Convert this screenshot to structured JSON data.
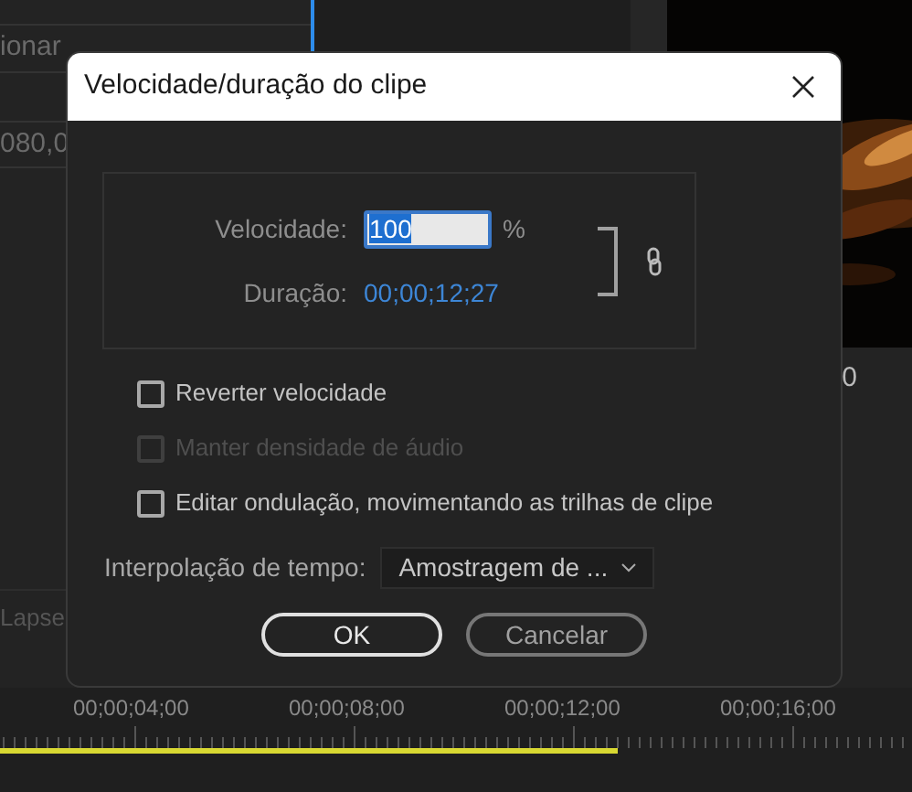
{
  "background": {
    "left_panel": [
      "ionar",
      "080,0"
    ],
    "track_label": "Lapse",
    "right_panel_value": "0"
  },
  "timeline": {
    "ticks": [
      "00;00;04;00",
      "00;00;08;00",
      "00;00;12;00",
      "00;00;16;00"
    ],
    "level": 0.678
  },
  "dialog": {
    "title": "Velocidade/duração do clipe",
    "speed": {
      "label": "Velocidade:",
      "value": "100",
      "value_highlighted": true,
      "unit": "%"
    },
    "duration": {
      "label": "Duração:",
      "value": "00;00;12;27"
    },
    "linked": true,
    "options": [
      {
        "label": "Reverter velocidade",
        "checked": false,
        "disabled": false
      },
      {
        "label": "Manter densidade de áudio",
        "checked": false,
        "disabled": true
      },
      {
        "label": "Editar ondulação, movimentando as trilhas de clipe",
        "checked": false,
        "disabled": false
      }
    ],
    "interpolation": {
      "label": "Interpolação de tempo:",
      "value": "Amostragem de ..."
    },
    "buttons": [
      {
        "label": "OK",
        "kind": "primary"
      },
      {
        "label": "Cancelar",
        "kind": "secondary"
      }
    ]
  }
}
